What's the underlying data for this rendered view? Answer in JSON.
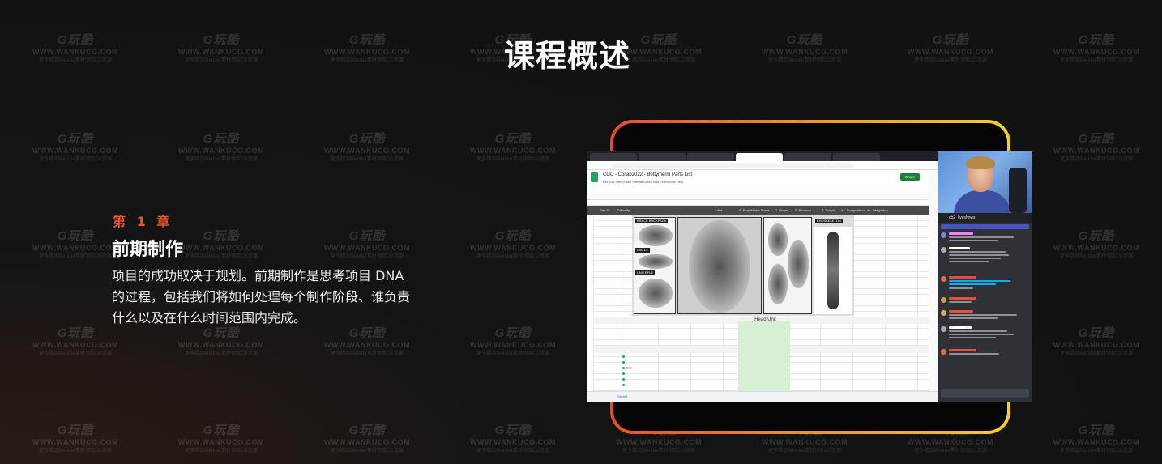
{
  "page": {
    "title": "课程概述"
  },
  "chapter": {
    "label": "第 1 章",
    "title": "前期制作",
    "description": "项目的成功取决于规划。前期制作是思考项目 DNA 的过程，包括我们将如何处理每个制作阶段、谁负责什么以及在什么时间范围内完成。"
  },
  "watermark": {
    "logo": "G玩酷",
    "site": "WWW.WANKUCG.COM",
    "sub": "更多精品Blender素材领取CG资源"
  },
  "screenshot": {
    "doc_title": "CGC - Collab2022 - Bottymerm Parts List",
    "menus": "File  Edit  View  Insert  Format  Data  Tools  Extensions  Help",
    "share_label": "Share",
    "columns": [
      "Part ID",
      "Difficulty",
      "Artist",
      "A. Prop Model Sheet",
      "1. Props",
      "2. Blockout",
      "3. Sculpt",
      "4a. Composition",
      "4b. Integration"
    ],
    "ref_labels": [
      "BRACE BACKPACK",
      "LAG.L2",
      "UNIT.RFLE",
      "EXOSKELETON"
    ],
    "head_unit_label": "Head Unit",
    "body_unit_label": "Body Unit",
    "sheet_tab_label": "Sheet1",
    "chat_channel": "cb2_liveshows"
  },
  "colors": {
    "accent": "#e8552e",
    "frame_start": "#e84a2e",
    "frame_end": "#f6cd2e"
  }
}
